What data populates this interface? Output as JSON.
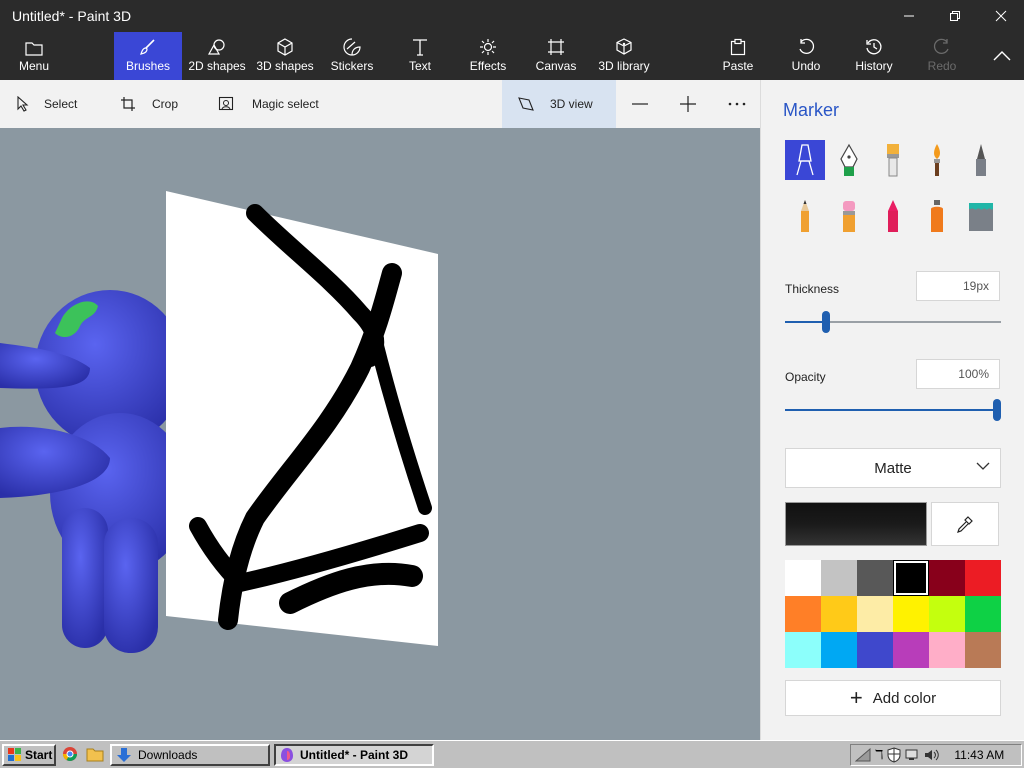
{
  "window": {
    "title": "Untitled* - Paint 3D"
  },
  "ribbon": {
    "menu": "Menu",
    "brushes": "Brushes",
    "shapes2d": "2D shapes",
    "shapes3d": "3D shapes",
    "stickers": "Stickers",
    "text": "Text",
    "effects": "Effects",
    "canvas": "Canvas",
    "library3d": "3D library",
    "paste": "Paste",
    "undo": "Undo",
    "history": "History",
    "redo": "Redo"
  },
  "subbar": {
    "select": "Select",
    "crop": "Crop",
    "magic_select": "Magic select",
    "view3d": "3D view",
    "zoom_out": "—",
    "zoom_in": "+",
    "more": "···"
  },
  "panel": {
    "title": "Marker",
    "thickness_label": "Thickness",
    "thickness_value": "19px",
    "thickness_fraction": 0.18,
    "opacity_label": "Opacity",
    "opacity_value": "100%",
    "opacity_fraction": 1.0,
    "finish": "Matte",
    "add_color": "Add color",
    "current_color": "#1a1a1a",
    "brushes": [
      "marker",
      "calligraphy-pen",
      "oil-brush",
      "watercolor",
      "pixel-pen",
      "pencil",
      "eraser",
      "crayon",
      "spray-can",
      "fill"
    ],
    "selected_brush": "marker",
    "swatches": [
      "#ffffff",
      "#c3c3c3",
      "#585858",
      "#000000",
      "#88001b",
      "#ec1c24",
      "#ff7f27",
      "#ffca18",
      "#fdeca6",
      "#fff200",
      "#c4ff0e",
      "#0ed145",
      "#8cfffb",
      "#00a8f3",
      "#3f48cc",
      "#b83dba",
      "#ffaec8",
      "#b97a56"
    ],
    "selected_swatch": 3
  },
  "taskbar": {
    "start": "Start",
    "downloads": "Downloads",
    "active_app": "Untitled* - Paint 3D",
    "clock": "11:43 AM"
  }
}
